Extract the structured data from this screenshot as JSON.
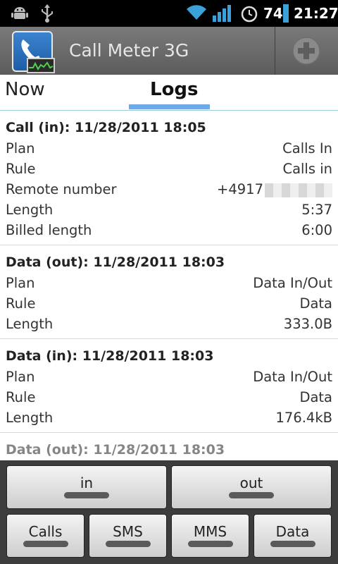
{
  "status_bar": {
    "battery": "74",
    "time": "21:27",
    "icons": [
      "android-debug-icon",
      "usb-icon",
      "wifi-icon",
      "signal-icon",
      "alarm-icon",
      "battery-icon"
    ]
  },
  "app": {
    "title": "Call Meter 3G",
    "icon": "phone-icon",
    "action_icon": "add-icon"
  },
  "tabs": [
    {
      "label": "Now",
      "selected": false
    },
    {
      "label": "Logs",
      "selected": true
    }
  ],
  "logs": [
    {
      "title": "Call (in): 11/28/2011 18:05",
      "rows": [
        {
          "label": "Plan",
          "value": "Calls In"
        },
        {
          "label": "Rule",
          "value": "Calls in"
        },
        {
          "label": "Remote number",
          "value": "+4917"
        },
        {
          "label": "Length",
          "value": "5:37"
        },
        {
          "label": "Billed length",
          "value": "6:00"
        }
      ]
    },
    {
      "title": "Data (out): 11/28/2011 18:03",
      "rows": [
        {
          "label": "Plan",
          "value": "Data In/Out"
        },
        {
          "label": "Rule",
          "value": "Data"
        },
        {
          "label": "Length",
          "value": "333.0B"
        }
      ]
    },
    {
      "title": "Data (in): 11/28/2011 18:03",
      "rows": [
        {
          "label": "Plan",
          "value": "Data In/Out"
        },
        {
          "label": "Rule",
          "value": "Data"
        },
        {
          "label": "Length",
          "value": "176.4kB"
        }
      ]
    },
    {
      "title": "Data (out): 11/28/2011 18:03",
      "rows": []
    }
  ],
  "filters": {
    "direction": [
      {
        "label": "in"
      },
      {
        "label": "out"
      }
    ],
    "types": [
      {
        "label": "Calls"
      },
      {
        "label": "SMS"
      },
      {
        "label": "MMS"
      },
      {
        "label": "Data"
      }
    ]
  },
  "colors": {
    "tab_indicator": "#6fa9e6",
    "titlebar": "#666666",
    "panel": "#3c3c3c"
  }
}
